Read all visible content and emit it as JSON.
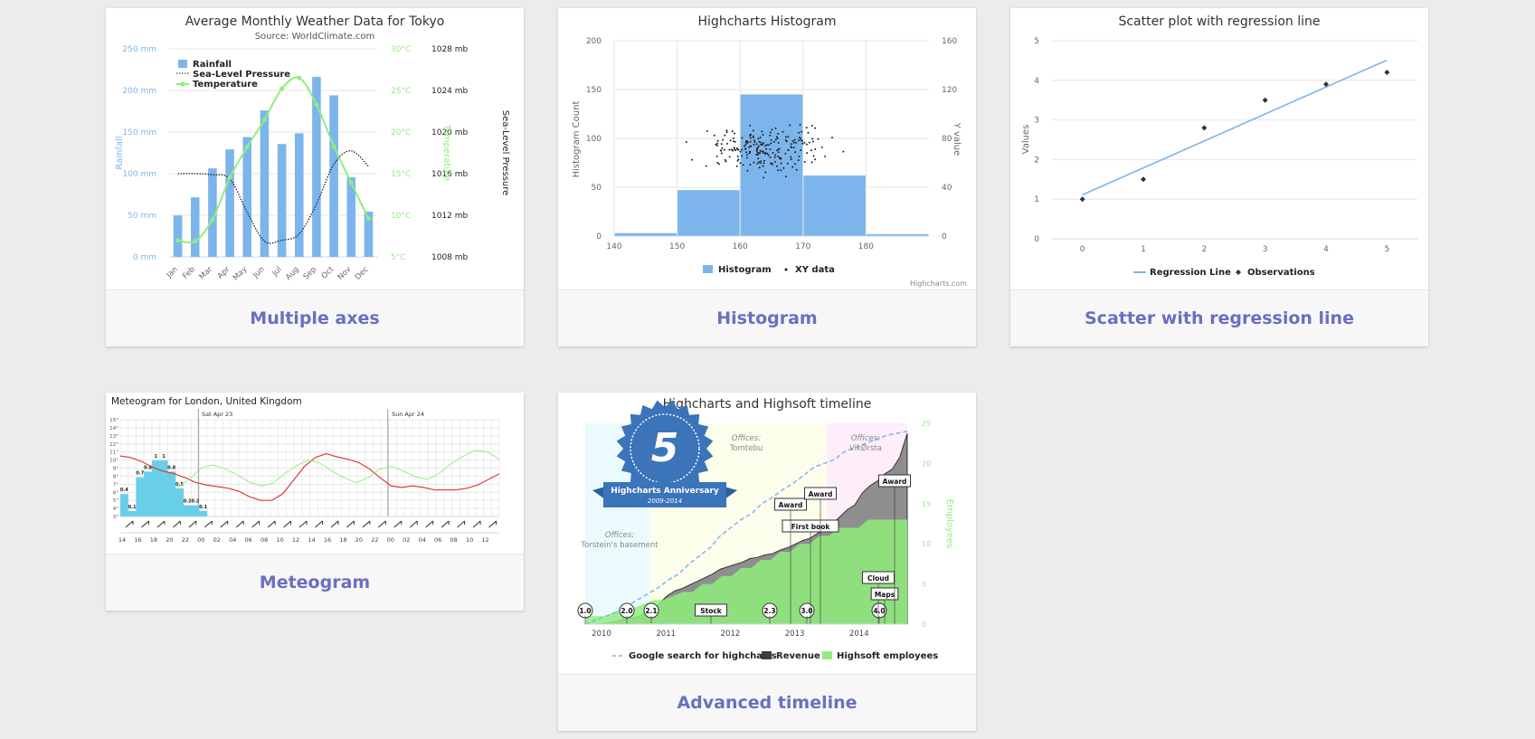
{
  "cards": [
    {
      "label": "Multiple axes"
    },
    {
      "label": "Histogram"
    },
    {
      "label": "Scatter with regression line"
    },
    {
      "label": "Meteogram"
    },
    {
      "label": "Advanced timeline"
    }
  ],
  "chart_data": [
    {
      "type": "bar",
      "title": "Average Monthly Weather Data for Tokyo",
      "subtitle": "Source: WorldClimate.com",
      "categories": [
        "Jan",
        "Feb",
        "Mar",
        "Apr",
        "May",
        "Jun",
        "Jul",
        "Aug",
        "Sep",
        "Oct",
        "Nov",
        "Dec"
      ],
      "series": [
        {
          "name": "Rainfall",
          "type": "bar",
          "values": [
            49.9,
            71.5,
            106.4,
            129.2,
            144.0,
            176.0,
            135.6,
            148.5,
            216.4,
            194.1,
            95.6,
            54.4
          ]
        },
        {
          "name": "Sea-Level Pressure",
          "type": "line",
          "values": [
            1016,
            1016,
            1015.9,
            1015.5,
            1012.3,
            1009.5,
            1009.6,
            1010.2,
            1013.1,
            1016.9,
            1018.2,
            1016.7
          ]
        },
        {
          "name": "Temperature",
          "type": "line",
          "values": [
            7.0,
            6.9,
            9.5,
            14.5,
            18.2,
            21.5,
            25.2,
            26.5,
            23.3,
            18.3,
            13.9,
            9.6
          ]
        }
      ],
      "axes": {
        "rainfall": {
          "label": "Rainfall",
          "ticks": [
            "0 mm",
            "50 mm",
            "100 mm",
            "150 mm",
            "200 mm",
            "250 mm"
          ],
          "ylim": [
            0,
            250
          ]
        },
        "temperature": {
          "label": "Temperature",
          "ticks": [
            "5°C",
            "10°C",
            "15°C",
            "20°C",
            "25°C",
            "30°C"
          ],
          "ylim": [
            5,
            30
          ]
        },
        "pressure": {
          "label": "Sea-Level Pressure",
          "ticks": [
            "1008 mb",
            "1012 mb",
            "1016 mb",
            "1020 mb",
            "1024 mb",
            "1028 mb"
          ],
          "ylim": [
            1008,
            1028
          ]
        }
      },
      "legend": [
        "Rainfall",
        "Sea-Level Pressure",
        "Temperature"
      ],
      "colors": {
        "rainfall": "#7cb5ec",
        "temperature": "#90ed7d",
        "pressure": "#222222"
      }
    },
    {
      "type": "bar",
      "title": "Highcharts Histogram",
      "bins": [
        {
          "from": 140,
          "to": 150,
          "count": 3
        },
        {
          "from": 150,
          "to": 160,
          "count": 47
        },
        {
          "from": 160,
          "to": 170,
          "count": 145
        },
        {
          "from": 170,
          "to": 180,
          "count": 62
        },
        {
          "from": 180,
          "to": 190,
          "count": 2
        }
      ],
      "xticks": [
        "140",
        "150",
        "160",
        "170",
        "180"
      ],
      "ylabel": "Histogram Count",
      "yticks": [
        "0",
        "50",
        "100",
        "150",
        "200"
      ],
      "y2label": "Y value",
      "y2ticks": [
        "0",
        "40",
        "80",
        "120",
        "160"
      ],
      "legend": [
        "Histogram",
        "XY data"
      ],
      "credit": "Highcharts.com",
      "colors": {
        "bar": "#7cb5ec",
        "dots": "#222222"
      }
    },
    {
      "type": "scatter",
      "title": "Scatter plot with regression line",
      "ylabel": "Values",
      "xticks": [
        "0",
        "1",
        "2",
        "3",
        "4",
        "5"
      ],
      "yticks": [
        "0",
        "1",
        "2",
        "3",
        "4",
        "5"
      ],
      "observations": [
        [
          0,
          1.0
        ],
        [
          1,
          1.5
        ],
        [
          2,
          2.8
        ],
        [
          3,
          3.5
        ],
        [
          4,
          3.9
        ],
        [
          5,
          4.2
        ]
      ],
      "regression": [
        [
          0,
          1.11
        ],
        [
          5,
          4.51
        ]
      ],
      "legend": [
        "Regression Line",
        "Observations"
      ],
      "colors": {
        "line": "#7cb5ec",
        "points": "#333333"
      }
    },
    {
      "type": "line",
      "title": "Meteogram for London, United Kingdom",
      "days": [
        "Sat Apr 23",
        "Sun Apr 24"
      ],
      "xticks": [
        "14",
        "16",
        "18",
        "20",
        "22",
        "00",
        "02",
        "04",
        "06",
        "08",
        "10",
        "12",
        "14",
        "16",
        "18",
        "20",
        "22",
        "00",
        "02",
        "04",
        "06",
        "08",
        "10",
        "12"
      ],
      "yticks": [
        "3°",
        "4°",
        "5°",
        "6°",
        "7°",
        "8°",
        "9°",
        "10°",
        "11°",
        "12°",
        "13°",
        "14°",
        "15°"
      ],
      "precip_labels": [
        "0.4",
        "0.1",
        "0.7",
        "0.8",
        "1",
        "1",
        "0.8",
        "0.5",
        "0.2",
        "0.2",
        "0.1"
      ],
      "precipitation": [
        0.4,
        0.1,
        0.7,
        0.8,
        1,
        1,
        0.8,
        0.5,
        0.2,
        0.2,
        0.1
      ],
      "temperature": [
        10.5,
        10.3,
        9.8,
        9.1,
        8.6,
        8.3,
        7.8,
        7.2,
        6.9,
        6.7,
        6.5,
        6.1,
        5.4,
        5.0,
        5.0,
        5.8,
        7.5,
        9.2,
        10.3,
        10.8,
        10.4,
        10.1,
        9.7,
        8.9,
        7.8,
        6.8,
        6.6,
        6.8,
        6.6,
        6.3,
        6.3,
        6.3,
        6.5,
        6.9,
        7.6,
        8.3
      ],
      "colors": {
        "temperature": "#e03a3a",
        "pressure": "#90ed7d",
        "precip": "#68cfe8"
      }
    },
    {
      "type": "area",
      "title": "Highcharts and Highsoft timeline",
      "xticks": [
        "2010",
        "2011",
        "2012",
        "2013",
        "2014"
      ],
      "y2label": "Employees",
      "y2ticks": [
        "0",
        "5",
        "10",
        "15",
        "20",
        "25"
      ],
      "badge": {
        "number": "5",
        "line1": "Highcharts Anniversary",
        "line2": "2009-2014"
      },
      "offices": [
        {
          "label": "Offices:",
          "name": "Torstein's basement"
        },
        {
          "label": "Offices:",
          "name": "Tomtebu"
        },
        {
          "label": "Offices:",
          "name": "VikØrsta"
        }
      ],
      "flags": [
        "1.0",
        "2.0",
        "2.1",
        "Stock",
        "2.3",
        "3.0",
        "4.0",
        "Cloud",
        "Maps",
        "First book",
        "Award",
        "Award",
        "Award"
      ],
      "legend": [
        "Google search for highcharts",
        "Revenue",
        "Highsoft employees"
      ],
      "colors": {
        "search": "#7cb5ec",
        "revenue": "#3d3d3d",
        "employees": "#90ed7d"
      }
    }
  ]
}
